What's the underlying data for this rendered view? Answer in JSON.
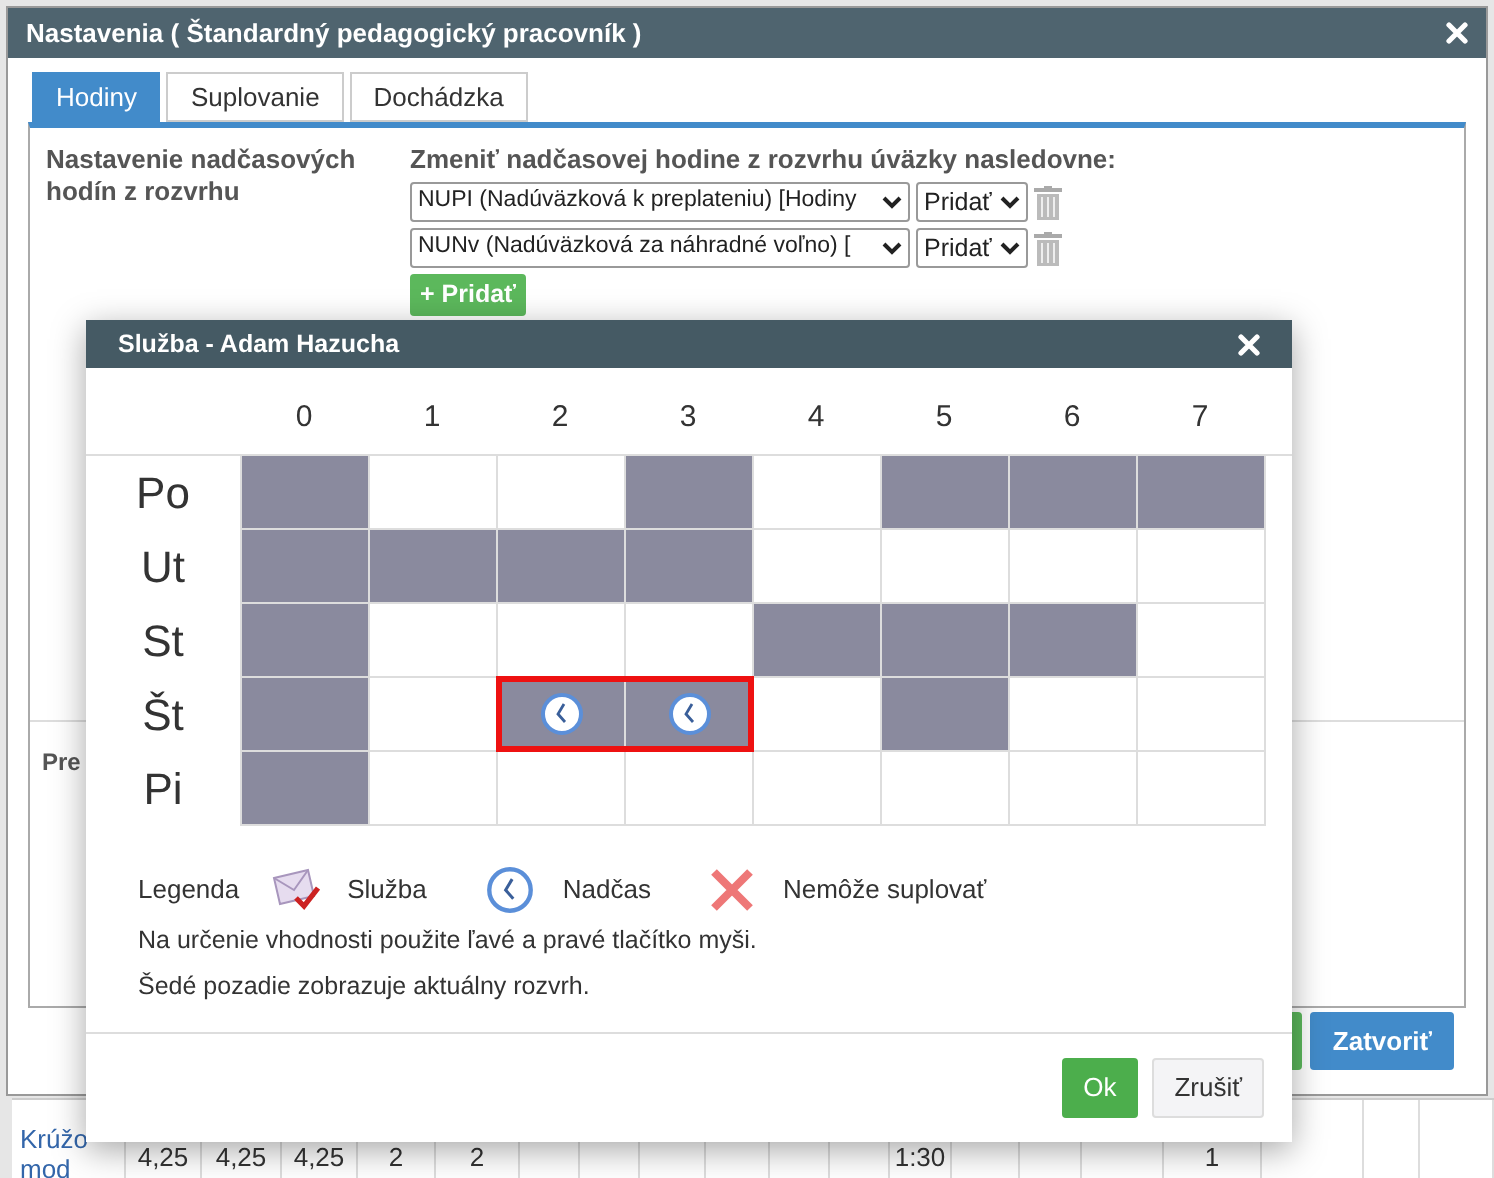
{
  "dialog": {
    "title": "Nastavenia ( Štandardný pedagogický pracovník )",
    "tabs": [
      {
        "label": "Hodiny",
        "selected": true
      },
      {
        "label": "Suplovanie",
        "selected": false
      },
      {
        "label": "Dochádzka",
        "selected": false
      }
    ],
    "section_label": "Nastavenie nadčasových hodín z rozvrhu",
    "rules_heading": "Zmeniť nadčasovej hodine z rozvrhu úväzky nasledovne:",
    "rules": [
      {
        "type": "NUPI (Nadúväzková k preplateniu) [Hodiny",
        "action": "Pridať"
      },
      {
        "type": "NUNv (Nadúväzková za náhradné voľno) [",
        "action": "Pridať"
      }
    ],
    "add_button": "+ Pridať",
    "lower_label": "Pre",
    "close_button": "Zatvoriť"
  },
  "popup": {
    "title": "Služba - Adam Hazucha",
    "columns": [
      "0",
      "1",
      "2",
      "3",
      "4",
      "5",
      "6",
      "7"
    ],
    "rows": [
      {
        "day": "Po",
        "cells": [
          {
            "scheduled": true,
            "overtime": false,
            "marked": false
          },
          {
            "scheduled": false,
            "overtime": false,
            "marked": false
          },
          {
            "scheduled": false,
            "overtime": false,
            "marked": false
          },
          {
            "scheduled": true,
            "overtime": false,
            "marked": false
          },
          {
            "scheduled": false,
            "overtime": false,
            "marked": false
          },
          {
            "scheduled": true,
            "overtime": false,
            "marked": false
          },
          {
            "scheduled": true,
            "overtime": false,
            "marked": false
          },
          {
            "scheduled": true,
            "overtime": false,
            "marked": false
          }
        ]
      },
      {
        "day": "Ut",
        "cells": [
          {
            "scheduled": true,
            "overtime": false,
            "marked": false
          },
          {
            "scheduled": true,
            "overtime": false,
            "marked": false
          },
          {
            "scheduled": true,
            "overtime": false,
            "marked": false
          },
          {
            "scheduled": true,
            "overtime": false,
            "marked": false
          },
          {
            "scheduled": false,
            "overtime": false,
            "marked": false
          },
          {
            "scheduled": false,
            "overtime": false,
            "marked": false
          },
          {
            "scheduled": false,
            "overtime": false,
            "marked": false
          },
          {
            "scheduled": false,
            "overtime": false,
            "marked": false
          }
        ]
      },
      {
        "day": "St",
        "cells": [
          {
            "scheduled": true,
            "overtime": false,
            "marked": false
          },
          {
            "scheduled": false,
            "overtime": false,
            "marked": false
          },
          {
            "scheduled": false,
            "overtime": false,
            "marked": false
          },
          {
            "scheduled": false,
            "overtime": false,
            "marked": false
          },
          {
            "scheduled": true,
            "overtime": false,
            "marked": false
          },
          {
            "scheduled": true,
            "overtime": false,
            "marked": false
          },
          {
            "scheduled": true,
            "overtime": false,
            "marked": false
          },
          {
            "scheduled": false,
            "overtime": false,
            "marked": false
          }
        ]
      },
      {
        "day": "Št",
        "cells": [
          {
            "scheduled": true,
            "overtime": false,
            "marked": false
          },
          {
            "scheduled": false,
            "overtime": false,
            "marked": false
          },
          {
            "scheduled": true,
            "overtime": true,
            "marked": true
          },
          {
            "scheduled": true,
            "overtime": true,
            "marked": true
          },
          {
            "scheduled": false,
            "overtime": false,
            "marked": false
          },
          {
            "scheduled": true,
            "overtime": false,
            "marked": false
          },
          {
            "scheduled": false,
            "overtime": false,
            "marked": false
          },
          {
            "scheduled": false,
            "overtime": false,
            "marked": false
          }
        ]
      },
      {
        "day": "Pi",
        "cells": [
          {
            "scheduled": true,
            "overtime": false,
            "marked": false
          },
          {
            "scheduled": false,
            "overtime": false,
            "marked": false
          },
          {
            "scheduled": false,
            "overtime": false,
            "marked": false
          },
          {
            "scheduled": false,
            "overtime": false,
            "marked": false
          },
          {
            "scheduled": false,
            "overtime": false,
            "marked": false
          },
          {
            "scheduled": false,
            "overtime": false,
            "marked": false
          },
          {
            "scheduled": false,
            "overtime": false,
            "marked": false
          },
          {
            "scheduled": false,
            "overtime": false,
            "marked": false
          }
        ]
      }
    ],
    "legend_title": "Legenda",
    "legend": [
      {
        "kind": "service",
        "label": "Služba"
      },
      {
        "kind": "overtime",
        "label": "Nadčas"
      },
      {
        "kind": "blocked",
        "label": "Nemôže suplovať"
      }
    ],
    "notes": [
      "Na určenie vhodnosti použite ľavé a pravé tlačítko myši.",
      "Šedé pozadie zobrazuje aktuálny rozvrh."
    ],
    "ok_button": "Ok",
    "cancel_button": "Zrušiť"
  },
  "background_table": {
    "label_lines": [
      "Krúžo",
      "mod"
    ],
    "cells": [
      "4,25",
      "4,25",
      "4,25",
      "2",
      "2",
      "1:30",
      "1"
    ]
  }
}
